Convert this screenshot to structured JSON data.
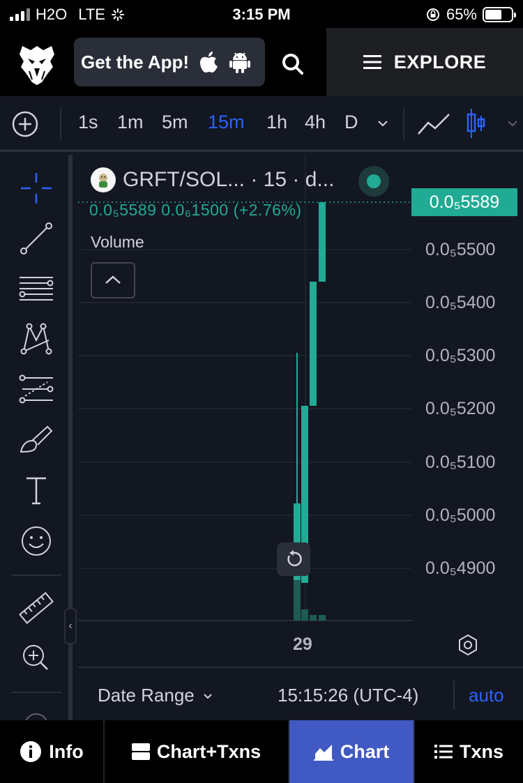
{
  "status_bar": {
    "carrier": "H2O",
    "network": "LTE",
    "time": "3:15 PM",
    "battery": "65%",
    "battery_level": 0.65
  },
  "header": {
    "get_app_label": "Get the App!",
    "explore_label": "EXPLORE"
  },
  "timeframes": {
    "items": [
      "1s",
      "1m",
      "5m",
      "15m",
      "1h",
      "4h",
      "D"
    ],
    "active": "15m"
  },
  "chart": {
    "symbol_title": "GRFT/SOL... · 15 · d...",
    "ohlc_text": "0.0₅5589  0.0₆1500 (+2.76%)",
    "volume_label": "Volume",
    "last_price_tag": "0.0₅5589",
    "price_labels": [
      "0.0₅5500",
      "0.0₅5400",
      "0.0₅5300",
      "0.0₅5200",
      "0.0₅5100",
      "0.0₅5000",
      "0.0₅4900"
    ],
    "x_label": "29",
    "colors": {
      "up": "#22ab94",
      "accent": "#2962ff",
      "background": "#131722"
    }
  },
  "date_bar": {
    "date_range_label": "Date Range",
    "timezone_text": "15:15:26 (UTC-4)",
    "auto_label": "auto"
  },
  "bottom_tabs": {
    "info": "Info",
    "chart_txns": "Chart+Txns",
    "chart": "Chart",
    "txns": "Txns",
    "active": "Chart"
  }
}
